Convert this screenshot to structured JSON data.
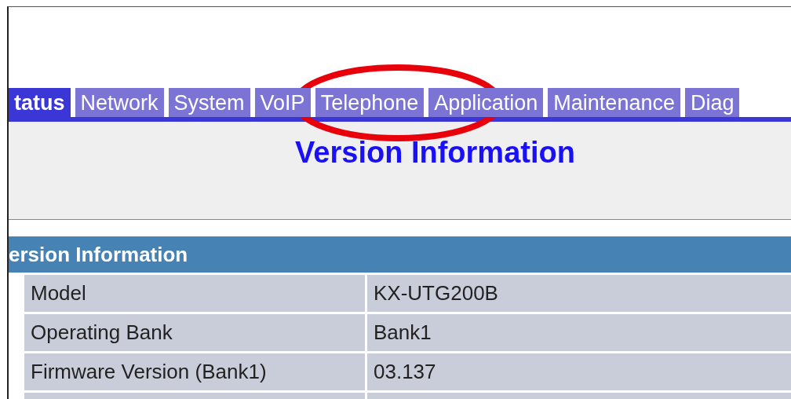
{
  "tabs": [
    {
      "label": "tatus",
      "selected": true
    },
    {
      "label": "Network",
      "selected": false
    },
    {
      "label": "System",
      "selected": false
    },
    {
      "label": "VoIP",
      "selected": false
    },
    {
      "label": "Telephone",
      "selected": false
    },
    {
      "label": "Application",
      "selected": false
    },
    {
      "label": "Maintenance",
      "selected": false
    },
    {
      "label": "Diag",
      "selected": false
    }
  ],
  "page_title": "Version Information",
  "section": {
    "title": "ersion Information",
    "rows": [
      {
        "label": "Model",
        "value": "KX-UTG200B"
      },
      {
        "label": "Operating Bank",
        "value": "Bank1"
      },
      {
        "label": "Firmware Version (Bank1)",
        "value": "03.137"
      }
    ]
  }
}
